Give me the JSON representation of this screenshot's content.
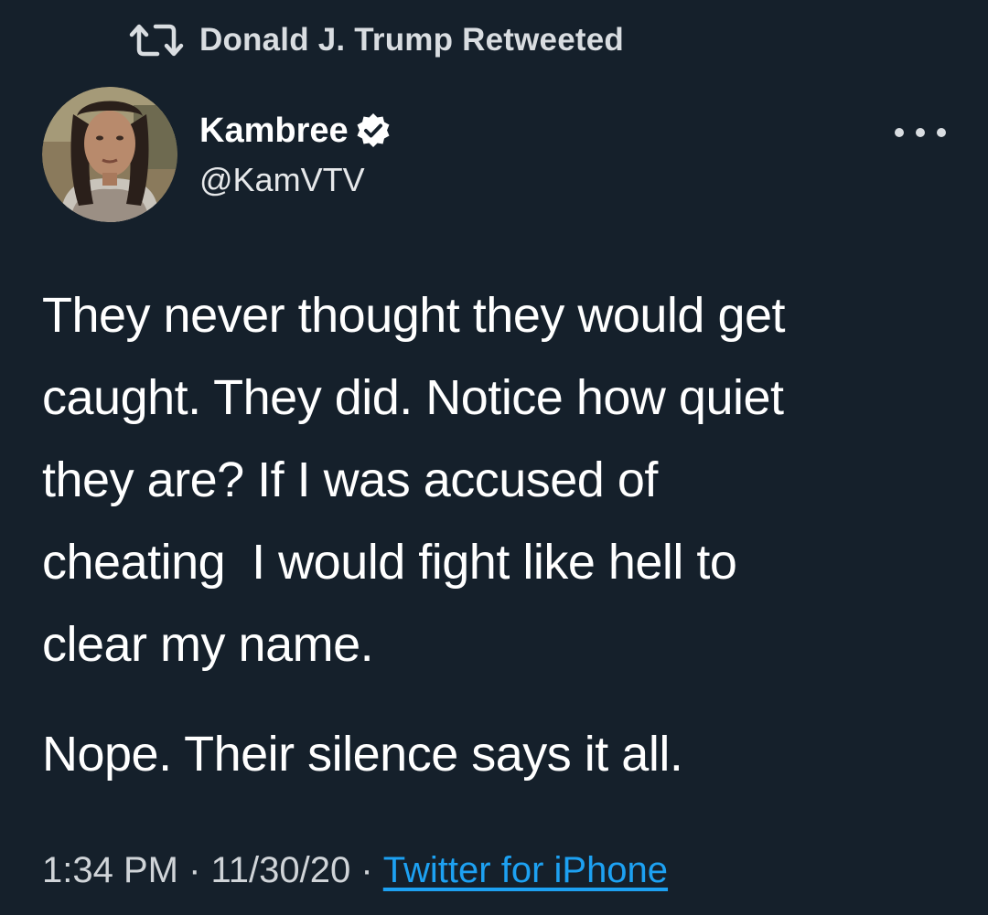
{
  "retweet": {
    "text": "Donald J. Trump Retweeted",
    "icon": "retweet-icon"
  },
  "author": {
    "display_name": "Kambree",
    "handle": "@KamVTV",
    "verified": true,
    "avatar_icon": "avatar-photo"
  },
  "tweet": {
    "lines": [
      "They never thought they would get",
      "caught. They did. Notice how quiet",
      "they are? If I was accused of",
      "cheating  I would fight like hell to",
      "clear my name."
    ],
    "paragraph_2": "Nope. Their silence says it all."
  },
  "meta": {
    "time": "1:34 PM",
    "separator": " · ",
    "date": "11/30/20",
    "source": "Twitter for iPhone"
  },
  "colors": {
    "background": "#15202b",
    "link": "#1da1f2",
    "verified_badge": "#ffffff"
  }
}
